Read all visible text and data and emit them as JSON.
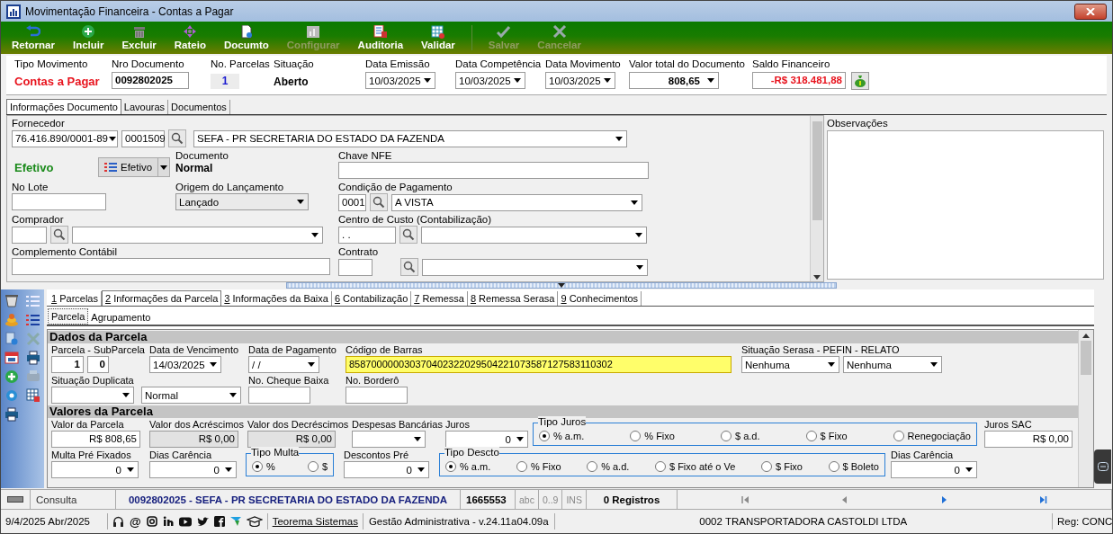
{
  "window": {
    "title": "Movimentação Financeira - Contas a Pagar"
  },
  "toolbar": {
    "main": [
      {
        "label": "Retornar",
        "disabled": false
      },
      {
        "label": "Incluir",
        "disabled": false
      },
      {
        "label": "Excluir",
        "disabled": false
      },
      {
        "label": "Rateio",
        "disabled": false
      },
      {
        "label": "Documto",
        "disabled": false
      },
      {
        "label": "Configurar",
        "disabled": true
      },
      {
        "label": "Auditoria",
        "disabled": false
      },
      {
        "label": "Validar",
        "disabled": false
      }
    ],
    "edit": [
      {
        "label": "Salvar",
        "disabled": true
      },
      {
        "label": "Cancelar",
        "disabled": true
      }
    ]
  },
  "header": [
    {
      "label": "Tipo Movimento",
      "value": "Contas a Pagar",
      "kind": "status"
    },
    {
      "label": "Nro Documento",
      "value": "0092802025",
      "kind": "input"
    },
    {
      "label": "No. Parcelas",
      "value": "1",
      "kind": "counter"
    },
    {
      "label": "Situação",
      "value": "Aberto",
      "kind": "text"
    },
    {
      "label": "Data Emissão",
      "value": "10/03/2025",
      "kind": "date"
    },
    {
      "label": "Data Competência",
      "value": "10/03/2025",
      "kind": "date"
    },
    {
      "label": "Data Movimento",
      "value": "10/03/2025",
      "kind": "date"
    },
    {
      "label": "Valor total do Documento",
      "value": "808,65",
      "kind": "amount"
    },
    {
      "label": "Saldo Financeiro",
      "value": "-R$ 318.481,88",
      "kind": "balance"
    }
  ],
  "document_tabs": [
    {
      "label": "Informações Documento",
      "selected": true
    },
    {
      "label": "Lavouras",
      "selected": false
    },
    {
      "label": "Documentos",
      "selected": false
    }
  ],
  "document": {
    "fornecedor": {
      "label": "Fornecedor",
      "cnpj": "76.416.890/0001-89",
      "code": "0001509",
      "name": "SEFA - PR SECRETARIA DO ESTADO DA FAZENDA"
    },
    "efetivo": {
      "status": "Efetivo",
      "button": "Efetivo"
    },
    "documento": {
      "label": "Documento",
      "value": "Normal"
    },
    "chave_nfe": {
      "label": "Chave NFE"
    },
    "no_lote": {
      "label": "No Lote"
    },
    "origem": {
      "label": "Origem do Lançamento",
      "value": "Lançado"
    },
    "condicao_pagamento": {
      "label": "Condição de Pagamento",
      "code": "0001",
      "name": "A VISTA"
    },
    "comprador": {
      "label": "Comprador"
    },
    "centro_custo": {
      "label": "Centro de Custo (Contabilização)",
      "code": " .  ."
    },
    "complemento": {
      "label": "Complemento Contábil"
    },
    "contrato": {
      "label": "Contrato"
    }
  },
  "observacoes": {
    "label": "Observações"
  },
  "parcela_tabs": [
    {
      "key": "1",
      "label": "Parcelas",
      "selected": false
    },
    {
      "key": "2",
      "label": "Informações da Parcela",
      "selected": true
    },
    {
      "key": "3",
      "label": "Informações da Baixa",
      "selected": false
    },
    {
      "key": "6",
      "label": "Contabilização",
      "selected": false
    },
    {
      "key": "7",
      "label": "Remessa",
      "selected": false
    },
    {
      "key": "8",
      "label": "Remessa Serasa",
      "selected": false
    },
    {
      "key": "9",
      "label": "Conhecimentos",
      "selected": false
    }
  ],
  "sub_tabs": [
    {
      "label": "Parcela",
      "selected": true
    },
    {
      "label": "Agrupamento",
      "selected": false
    }
  ],
  "sections": [
    {
      "title": "Dados da Parcela",
      "rows": [
        [
          {
            "kind": "field",
            "label": "Parcela - SubParcela",
            "controls": [
              {
                "kind": "number",
                "value": "1"
              },
              {
                "kind": "number",
                "value": "0"
              }
            ]
          },
          {
            "kind": "field",
            "label": "Data de Vencimento",
            "controls": [
              {
                "kind": "dropdown",
                "value": "14/03/2025"
              }
            ]
          },
          {
            "kind": "field",
            "label": "Data de Pagamento",
            "controls": [
              {
                "kind": "dropdown",
                "value": " / /"
              }
            ]
          },
          {
            "kind": "field",
            "label": "Código de Barras",
            "controls": [
              {
                "kind": "text",
                "value": "858700000030370402322029504221073587127583110302",
                "highlighted": true
              }
            ]
          },
          {
            "kind": "field",
            "label": "Situação Serasa  - PEFIN - RELATO",
            "controls": [
              {
                "kind": "dropdown",
                "value": "Nenhuma"
              },
              {
                "kind": "dropdown",
                "value": "Nenhuma"
              }
            ]
          }
        ],
        [
          {
            "kind": "field",
            "label": "Situação Duplicata",
            "controls": [
              {
                "kind": "dropdown"
              }
            ]
          },
          {
            "kind": "field",
            "controls": [
              {
                "kind": "dropdown",
                "value": "Normal"
              }
            ]
          },
          {
            "kind": "field",
            "label": "No. Cheque Baixa",
            "controls": [
              {
                "kind": "text"
              }
            ]
          },
          {
            "kind": "field",
            "label": "No. Borderô",
            "controls": [
              {
                "kind": "text"
              }
            ]
          }
        ]
      ]
    },
    {
      "title": "Valores da Parcela",
      "rows": [
        [
          {
            "kind": "field",
            "label": "Valor da Parcela",
            "controls": [
              {
                "kind": "amount",
                "value": "R$ 808,65"
              }
            ]
          },
          {
            "kind": "field",
            "label": "Valor dos Acréscimos",
            "controls": [
              {
                "kind": "amount",
                "value": "R$ 0,00",
                "disabled": true
              }
            ]
          },
          {
            "kind": "field",
            "label": "Valor dos Decréscimos",
            "controls": [
              {
                "kind": "amount",
                "value": "R$ 0,00",
                "disabled": true
              }
            ]
          },
          {
            "kind": "field",
            "label": "Despesas Bancárias",
            "controls": [
              {
                "kind": "dropdown"
              }
            ]
          },
          {
            "kind": "field",
            "label": "Juros",
            "controls": [
              {
                "kind": "amount_dropdown",
                "value": "0"
              }
            ]
          },
          {
            "kind": "radios",
            "title": "Tipo Juros",
            "options": [
              {
                "label": "% a.m.",
                "selected": true
              },
              {
                "label": "% Fixo",
                "selected": false
              },
              {
                "label": "$ a.d.",
                "selected": false
              },
              {
                "label": "$ Fixo",
                "selected": false
              },
              {
                "label": "Renegociação",
                "selected": false
              }
            ]
          },
          {
            "kind": "field",
            "label": "Juros SAC",
            "controls": [
              {
                "kind": "amount",
                "value": "R$ 0,00"
              }
            ]
          }
        ],
        [
          {
            "kind": "field",
            "label": "Multa Pré Fixados",
            "controls": [
              {
                "kind": "amount_dropdown",
                "value": "0"
              }
            ]
          },
          {
            "kind": "field",
            "label": "Dias Carência",
            "controls": [
              {
                "kind": "amount_dropdown",
                "value": "0"
              }
            ]
          },
          {
            "kind": "radios",
            "title": "Tipo Multa",
            "options": [
              {
                "label": "%",
                "selected": true
              },
              {
                "label": "$",
                "selected": false
              }
            ]
          },
          {
            "kind": "field",
            "label": "Descontos Pré",
            "controls": [
              {
                "kind": "amount_dropdown",
                "value": "0"
              }
            ]
          },
          {
            "kind": "radios",
            "title": "Tipo Descto",
            "options": [
              {
                "label": "% a.m.",
                "selected": true
              },
              {
                "label": "% Fixo",
                "selected": false
              },
              {
                "label": "% a.d.",
                "selected": false
              },
              {
                "label": "$ Fixo até o Ve",
                "selected": false
              },
              {
                "label": "$ Fixo",
                "selected": false
              },
              {
                "label": "$ Boleto",
                "selected": false
              }
            ]
          },
          {
            "kind": "field",
            "label": "Dias Carência",
            "controls": [
              {
                "kind": "amount_dropdown",
                "value": "0"
              }
            ]
          }
        ]
      ]
    }
  ],
  "status_bar": {
    "mode": "Consulta",
    "record": "0092802025 - SEFA - PR SECRETARIA DO ESTADO DA FAZENDA",
    "code": "1665553",
    "indicators": [
      "abc",
      "0..9",
      "INS"
    ],
    "count": "0 Registros",
    "navigation": [
      {
        "disabled": true
      },
      {
        "disabled": true
      },
      {
        "disabled": false
      },
      {
        "disabled": false
      }
    ]
  },
  "footer": {
    "date": "9/4/2025 Abr/2025",
    "contact_symbol": "@",
    "link": "Teorema Sistemas",
    "version": "Gestão Administrativa - v.24.11a04.09a",
    "company": "0002 TRANSPORTADORA CASTOLDI LTDA",
    "reg": "Reg: CONC"
  }
}
